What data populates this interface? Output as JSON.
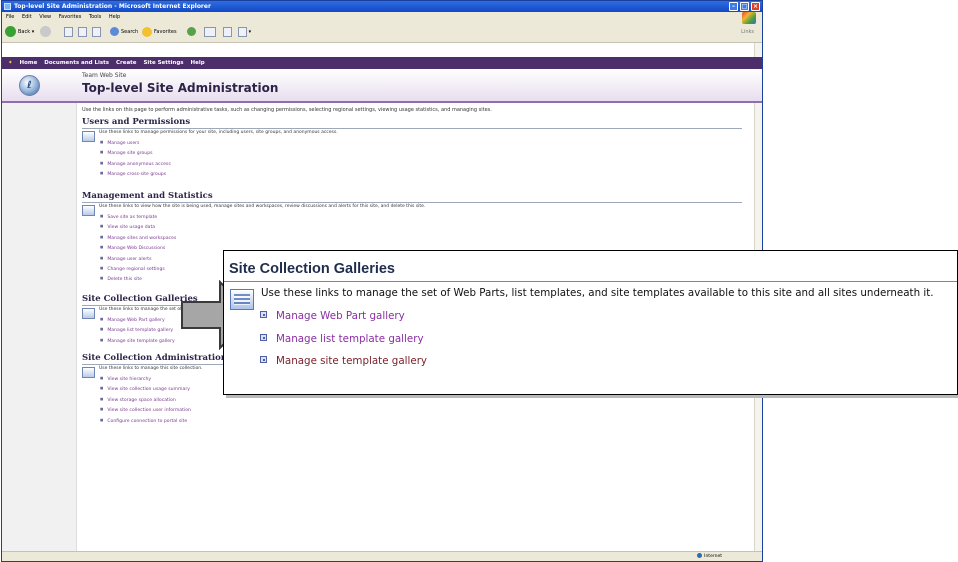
{
  "window": {
    "title": "Top-level Site Administration - Microsoft Internet Explorer",
    "menu": [
      "File",
      "Edit",
      "View",
      "Favorites",
      "Tools",
      "Help"
    ],
    "toolbar": {
      "back": "Back",
      "search": "Search",
      "favorites": "Favorites"
    },
    "links_label": "Links",
    "status_zone": "Internet"
  },
  "nav": [
    "Home",
    "Documents and Lists",
    "Create",
    "Site Settings",
    "Help"
  ],
  "header": {
    "site_name": "Team Web Site",
    "page_title": "Top-level Site Administration"
  },
  "intro": "Use the links on this page to perform administrative tasks, such as changing permissions, selecting regional settings, viewing usage statistics, and managing sites.",
  "sections": [
    {
      "title": "Users and Permissions",
      "desc": "Use these links to manage permissions for your site, including users, site groups, and anonymous access.",
      "links": [
        "Manage users",
        "Manage site groups",
        "Manage anonymous access",
        "Manage cross-site groups"
      ]
    },
    {
      "title": "Management and Statistics",
      "desc": "Use these links to view how the site is being used, manage sites and workspaces, review discussions and alerts for this site, and delete this site.",
      "links": [
        "Save site as template",
        "View site usage data",
        "Manage sites and workspaces",
        "Manage Web Discussions",
        "Manage user alerts",
        "Change regional settings",
        "Delete this site"
      ]
    },
    {
      "title": "Site Collection Galleries",
      "desc": "Use these links to manage the set of Web Parts, list templates, and site templates available to this site and all sites underneath it.",
      "links": [
        "Manage Web Part gallery",
        "Manage list template gallery",
        "Manage site template gallery"
      ]
    },
    {
      "title": "Site Collection Administration",
      "desc": "Use these links to manage this site collection.",
      "links": [
        "View site hierarchy",
        "View site collection usage summary",
        "View storage space allocation",
        "View site collection user information",
        "Configure connection to portal site"
      ]
    }
  ],
  "callout": {
    "title": "Site Collection Galleries",
    "desc": "Use these links to manage the set of Web Parts, list templates, and site templates available to this site and all sites underneath it.",
    "links": [
      "Manage Web Part gallery",
      "Manage list template gallery",
      "Manage site template gallery"
    ]
  }
}
